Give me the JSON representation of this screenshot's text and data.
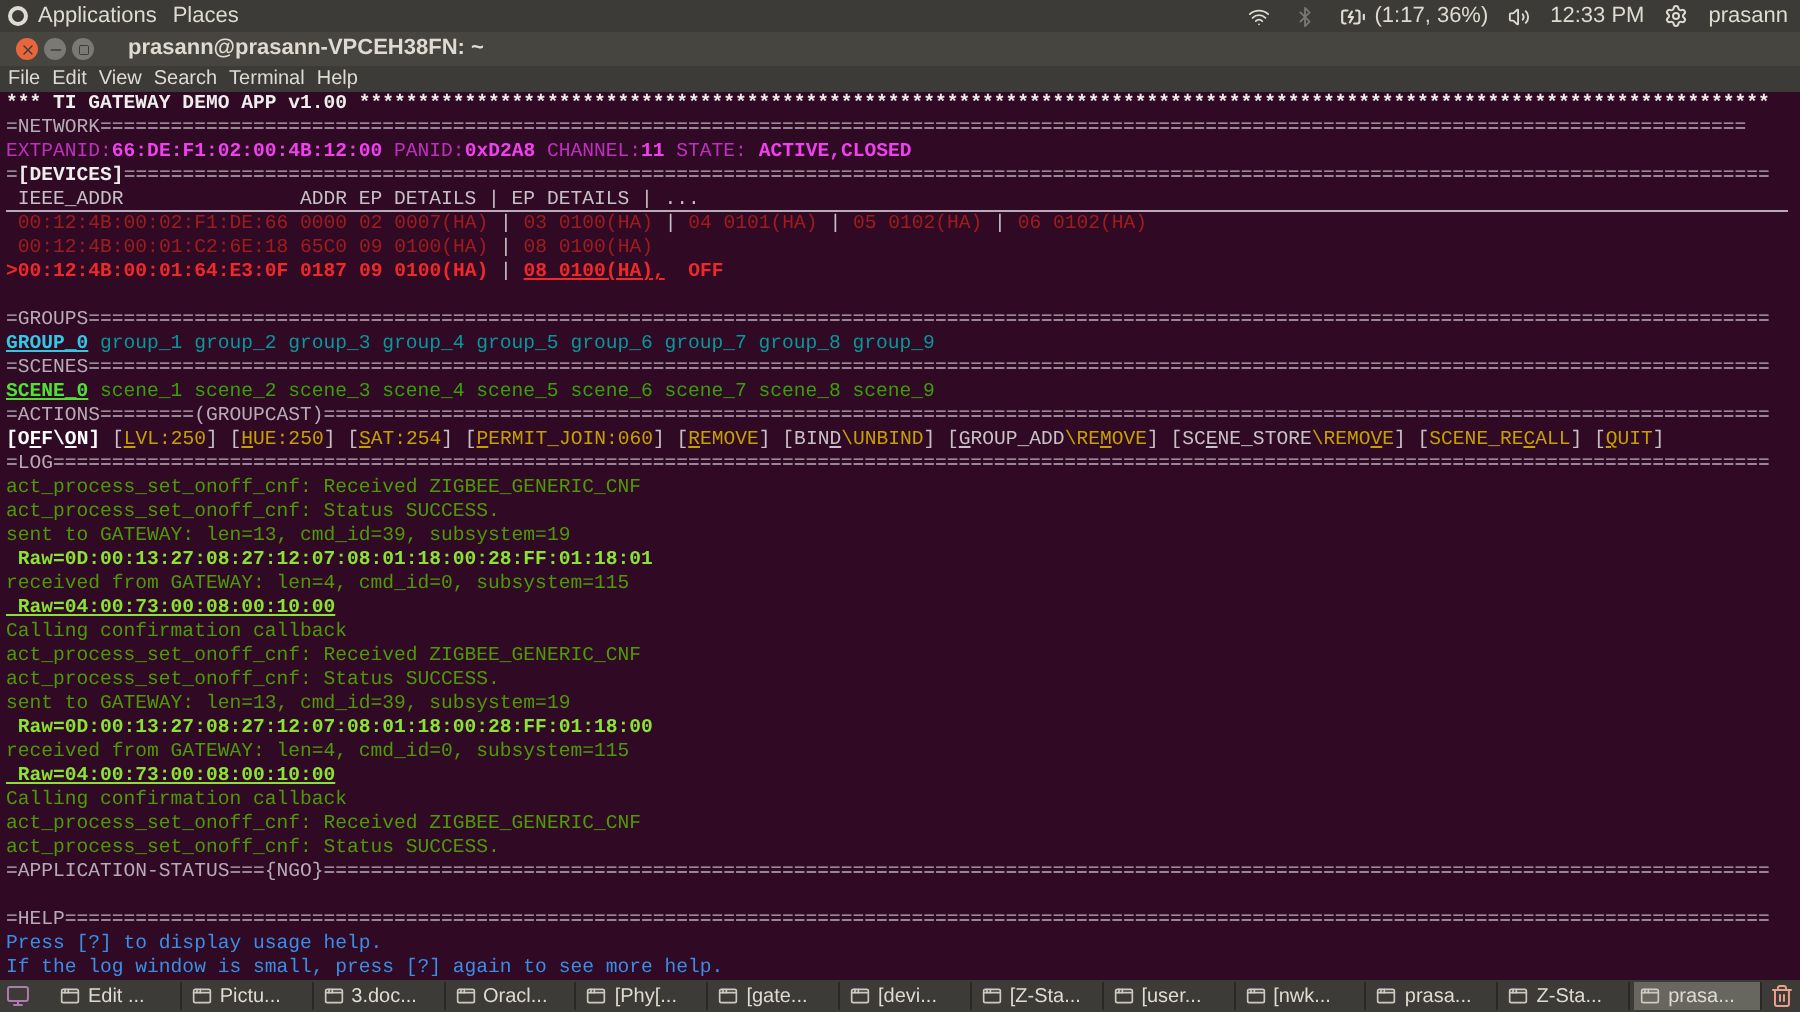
{
  "top_panel": {
    "menus": [
      "Applications",
      "Places"
    ],
    "battery": "(1:17, 36%)",
    "clock": "12:33 PM",
    "user": "prasann"
  },
  "window": {
    "title": "prasann@prasann-VPCEH38FN: ~",
    "menu": [
      "File",
      "Edit",
      "View",
      "Search",
      "Terminal",
      "Help"
    ]
  },
  "terminal": {
    "banner": "*** TI GATEWAY DEMO APP v1.00 ************************************************************************************************************************",
    "network": {
      "rule": "=NETWORK============================================================================================================================================",
      "line": [
        {
          "text": "EXTPANID:",
          "kind": "label"
        },
        {
          "text": "66:DE:F1:02:00:4B:12:00",
          "kind": "value"
        },
        {
          "text": " PANID:",
          "kind": "label"
        },
        {
          "text": "0xD2A8",
          "kind": "value"
        },
        {
          "text": " CHANNEL:",
          "kind": "label"
        },
        {
          "text": "11",
          "kind": "value"
        },
        {
          "text": " STATE: ",
          "kind": "label"
        },
        {
          "text": "ACTIVE,CLOSED",
          "kind": "value"
        }
      ]
    },
    "devices": {
      "rule": [
        {
          "text": "=",
          "kind": "rule"
        },
        {
          "text": "[DEVICES]",
          "kind": "title"
        },
        {
          "text": "============================================================================================================================================",
          "kind": "rule"
        }
      ],
      "header": " IEEE_ADDR               ADDR EP DETAILS | EP DETAILS | ...",
      "separator": "|",
      "rows": [
        {
          "selected": false,
          "ieee": "00:12:4B:00:02:F1:DE:66",
          "addr": "0000",
          "endpoints": [
            {
              "text": "02 0007(HA)",
              "selected": false
            },
            {
              "text": "03 0100(HA)",
              "selected": false
            },
            {
              "text": "04 0101(HA)",
              "selected": false
            },
            {
              "text": "05 0102(HA)",
              "selected": false
            },
            {
              "text": "06 0102(HA)",
              "selected": false
            }
          ]
        },
        {
          "selected": false,
          "ieee": "00:12:4B:00:01:C2:6E:18",
          "addr": "65C0",
          "endpoints": [
            {
              "text": "09 0100(HA)",
              "selected": false
            },
            {
              "text": "08 0100(HA)",
              "selected": false
            }
          ]
        },
        {
          "selected": true,
          "cursor": ">",
          "ieee": "00:12:4B:00:01:64:E3:0F",
          "addr": "0187",
          "endpoints": [
            {
              "text": "09 0100(HA)",
              "selected": false
            },
            {
              "text": "08 0100(HA),",
              "selected": true
            }
          ],
          "state": "OFF"
        }
      ]
    },
    "groups": {
      "rule": "=GROUPS===============================================================================================================================================",
      "items": [
        {
          "label": "GROUP_0",
          "selected": true
        },
        {
          "label": "group_1",
          "selected": false
        },
        {
          "label": "group_2",
          "selected": false
        },
        {
          "label": "group_3",
          "selected": false
        },
        {
          "label": "group_4",
          "selected": false
        },
        {
          "label": "group_5",
          "selected": false
        },
        {
          "label": "group_6",
          "selected": false
        },
        {
          "label": "group_7",
          "selected": false
        },
        {
          "label": "group_8",
          "selected": false
        },
        {
          "label": "group_9",
          "selected": false
        }
      ]
    },
    "scenes": {
      "rule": "=SCENES===============================================================================================================================================",
      "items": [
        {
          "label": "SCENE_0",
          "selected": true
        },
        {
          "label": "scene_1",
          "selected": false
        },
        {
          "label": "scene_2",
          "selected": false
        },
        {
          "label": "scene_3",
          "selected": false
        },
        {
          "label": "scene_4",
          "selected": false
        },
        {
          "label": "scene_5",
          "selected": false
        },
        {
          "label": "scene_6",
          "selected": false
        },
        {
          "label": "scene_7",
          "selected": false
        },
        {
          "label": "scene_8",
          "selected": false
        },
        {
          "label": "scene_9",
          "selected": false
        }
      ]
    },
    "actions": {
      "rule": "=ACTIONS========(GROUPCAST)===========================================================================================================================",
      "line": [
        {
          "text": "[O",
          "kind": "current"
        },
        {
          "text": "F",
          "kind": "current-key"
        },
        {
          "text": "F\\",
          "kind": "current"
        },
        {
          "text": "O",
          "kind": "current-key"
        },
        {
          "text": "N]",
          "kind": "current"
        },
        {
          "text": " [",
          "kind": "punct"
        },
        {
          "text": "L",
          "kind": "command-key"
        },
        {
          "text": "VL:250",
          "kind": "command"
        },
        {
          "text": "] [",
          "kind": "punct"
        },
        {
          "text": "H",
          "kind": "command-key"
        },
        {
          "text": "UE:250",
          "kind": "command"
        },
        {
          "text": "] [",
          "kind": "punct"
        },
        {
          "text": "S",
          "kind": "command-key"
        },
        {
          "text": "AT:254",
          "kind": "command"
        },
        {
          "text": "] [",
          "kind": "punct"
        },
        {
          "text": "P",
          "kind": "command-key"
        },
        {
          "text": "ERMIT_JOIN:060",
          "kind": "command"
        },
        {
          "text": "] [",
          "kind": "punct"
        },
        {
          "text": "R",
          "kind": "command-key"
        },
        {
          "text": "EMOVE",
          "kind": "command"
        },
        {
          "text": "] [BIN",
          "kind": "punct"
        },
        {
          "text": "D",
          "kind": "punct-key"
        },
        {
          "text": "\\UNBIND",
          "kind": "command"
        },
        {
          "text": "] [",
          "kind": "punct"
        },
        {
          "text": "G",
          "kind": "punct-key"
        },
        {
          "text": "ROUP_ADD",
          "kind": "punct"
        },
        {
          "text": "\\RE",
          "kind": "command"
        },
        {
          "text": "M",
          "kind": "command-key"
        },
        {
          "text": "OVE",
          "kind": "command"
        },
        {
          "text": "] [SC",
          "kind": "punct"
        },
        {
          "text": "E",
          "kind": "punct-key"
        },
        {
          "text": "NE_STORE",
          "kind": "punct"
        },
        {
          "text": "\\REMO",
          "kind": "command"
        },
        {
          "text": "V",
          "kind": "command-key"
        },
        {
          "text": "E",
          "kind": "command"
        },
        {
          "text": "] [",
          "kind": "punct"
        },
        {
          "text": "SCENE_RE",
          "kind": "command"
        },
        {
          "text": "C",
          "kind": "command-key"
        },
        {
          "text": "ALL",
          "kind": "command"
        },
        {
          "text": "] [",
          "kind": "punct"
        },
        {
          "text": "Q",
          "kind": "command-key"
        },
        {
          "text": "UIT",
          "kind": "command"
        },
        {
          "text": "]",
          "kind": "punct"
        }
      ]
    },
    "log": {
      "rule": "=LOG==================================================================================================================================================",
      "lines": [
        {
          "kind": "message",
          "text": "act_process_set_onoff_cnf: Received ZIGBEE_GENERIC_CNF"
        },
        {
          "kind": "message",
          "text": "act_process_set_onoff_cnf: Status SUCCESS."
        },
        {
          "kind": "message",
          "text": "sent to GATEWAY: len=13, cmd_id=39, subsystem=19"
        },
        {
          "kind": "raw",
          "text": " Raw=0D:00:13:27:08:27:12:07:08:01:18:00:28:FF:01:18:01"
        },
        {
          "kind": "message",
          "text": "received from GATEWAY: len=4, cmd_id=0, subsystem=115"
        },
        {
          "kind": "raw-underlined",
          "text": " Raw=04:00:73:00:08:00:10:00"
        },
        {
          "kind": "message",
          "text": "Calling confirmation callback"
        },
        {
          "kind": "message",
          "text": "act_process_set_onoff_cnf: Received ZIGBEE_GENERIC_CNF"
        },
        {
          "kind": "message",
          "text": "act_process_set_onoff_cnf: Status SUCCESS."
        },
        {
          "kind": "message",
          "text": "sent to GATEWAY: len=13, cmd_id=39, subsystem=19"
        },
        {
          "kind": "raw",
          "text": " Raw=0D:00:13:27:08:27:12:07:08:01:18:00:28:FF:01:18:00"
        },
        {
          "kind": "message",
          "text": "received from GATEWAY: len=4, cmd_id=0, subsystem=115"
        },
        {
          "kind": "raw-underlined",
          "text": " Raw=04:00:73:00:08:00:10:00"
        },
        {
          "kind": "message",
          "text": "Calling confirmation callback"
        },
        {
          "kind": "message",
          "text": "act_process_set_onoff_cnf: Received ZIGBEE_GENERIC_CNF"
        },
        {
          "kind": "message",
          "text": "act_process_set_onoff_cnf: Status SUCCESS."
        }
      ]
    },
    "app_status": {
      "rule": "=APPLICATION-STATUS==={NGO}==========================================================================================================================="
    },
    "help": {
      "rule": "=HELP=================================================================================================================================================",
      "lines": [
        "Press [?] to display usage help.",
        "If the log window is small, press [?] again to see more help."
      ]
    }
  },
  "taskbar": {
    "windows": [
      {
        "label": "Edit ...",
        "selected": false
      },
      {
        "label": "Pictu...",
        "selected": false
      },
      {
        "label": "3.doc...",
        "selected": false
      },
      {
        "label": "Oracl...",
        "selected": false
      },
      {
        "label": "[Phy[...",
        "selected": false
      },
      {
        "label": "[gate...",
        "selected": false
      },
      {
        "label": "[devi...",
        "selected": false
      },
      {
        "label": "[Z-Sta...",
        "selected": false
      },
      {
        "label": "[user...",
        "selected": false
      },
      {
        "label": "[nwk...",
        "selected": false
      },
      {
        "label": "prasa...",
        "selected": false
      },
      {
        "label": "Z-Sta...",
        "selected": false
      },
      {
        "label": "prasa...",
        "selected": true
      }
    ]
  }
}
